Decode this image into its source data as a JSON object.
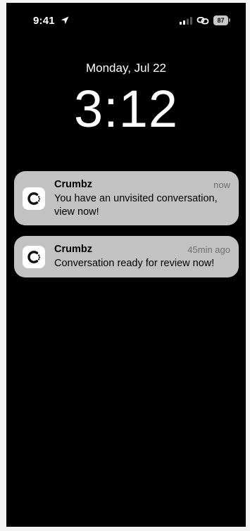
{
  "status_bar": {
    "time": "9:41",
    "battery_level": "87",
    "icons": [
      "location-arrow-icon",
      "cellular-signal-icon",
      "link-icon",
      "battery-icon"
    ]
  },
  "lock_screen": {
    "date": "Monday, Jul 22",
    "time": "3:12"
  },
  "notifications": [
    {
      "app_name": "Crumbz",
      "time": "now",
      "message": "You have an unvisited conversation, view now!",
      "icon": "crumbz-app-icon"
    },
    {
      "app_name": "Crumbz",
      "time": "45min ago",
      "message": "Conversation ready for review now!",
      "icon": "crumbz-app-icon"
    }
  ],
  "colors": {
    "background": "#000000",
    "notification_bg": "#c2c2c2",
    "text": "#ffffff",
    "secondary_text": "#6f6f6f",
    "page_margin": "#f3f3f3"
  }
}
